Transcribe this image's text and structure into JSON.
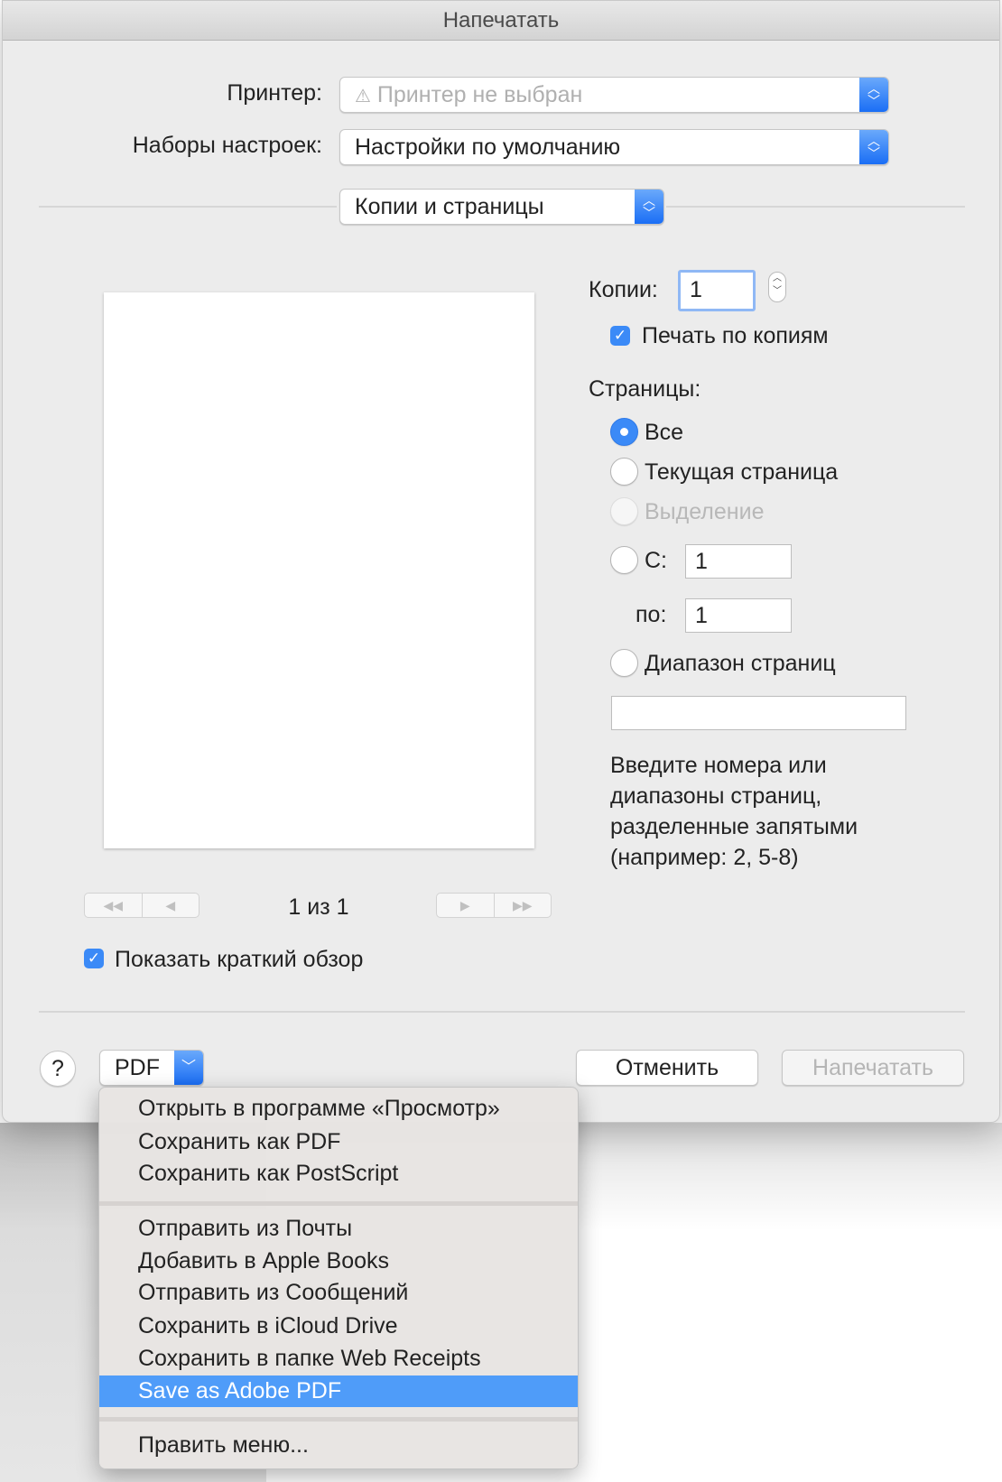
{
  "window": {
    "title": "Напечатать"
  },
  "printer": {
    "label": "Принтер:",
    "value": "Принтер не выбран",
    "icon": "warning-icon"
  },
  "presets": {
    "label": "Наборы настроек:",
    "value": "Настройки по умолчанию"
  },
  "section_popup": {
    "value": "Копии и страницы"
  },
  "copies": {
    "label": "Копии:",
    "value": "1",
    "collate_label": "Печать по копиям",
    "collate_checked": true
  },
  "pages": {
    "label": "Страницы:",
    "options": [
      {
        "label": "Все",
        "selected": true
      },
      {
        "label": "Текущая страница"
      },
      {
        "label": "Выделение",
        "disabled": true
      },
      {
        "label": "С:"
      },
      {
        "label": "Диапазон страниц"
      }
    ],
    "from_value": "1",
    "to_label": "по:",
    "to_value": "1",
    "range_value": "",
    "help_lines": [
      "Введите номера или",
      "диапазоны страниц,",
      "разделенные запятыми",
      "(например: 2, 5-8)"
    ]
  },
  "preview": {
    "page_indicator": "1 из 1",
    "show_details_label": "Показать краткий обзор",
    "show_details_checked": true
  },
  "footer": {
    "help": "?",
    "pdf": "PDF",
    "cancel": "Отменить",
    "print": "Напечатать"
  },
  "pdf_menu": {
    "group1": [
      "Открыть в программе «Просмотр»",
      "Сохранить как PDF",
      "Сохранить как PostScript"
    ],
    "group2": [
      "Отправить из Почты",
      "Добавить в Apple Books",
      "Отправить из Сообщений",
      "Сохранить в iCloud Drive",
      "Сохранить в папке Web Receipts",
      "Save as Adobe PDF"
    ],
    "highlighted": "Save as Adobe PDF",
    "group3": [
      "Править меню..."
    ]
  },
  "colors": {
    "accent": "#3b8af7",
    "highlight": "#4f9cf9"
  }
}
